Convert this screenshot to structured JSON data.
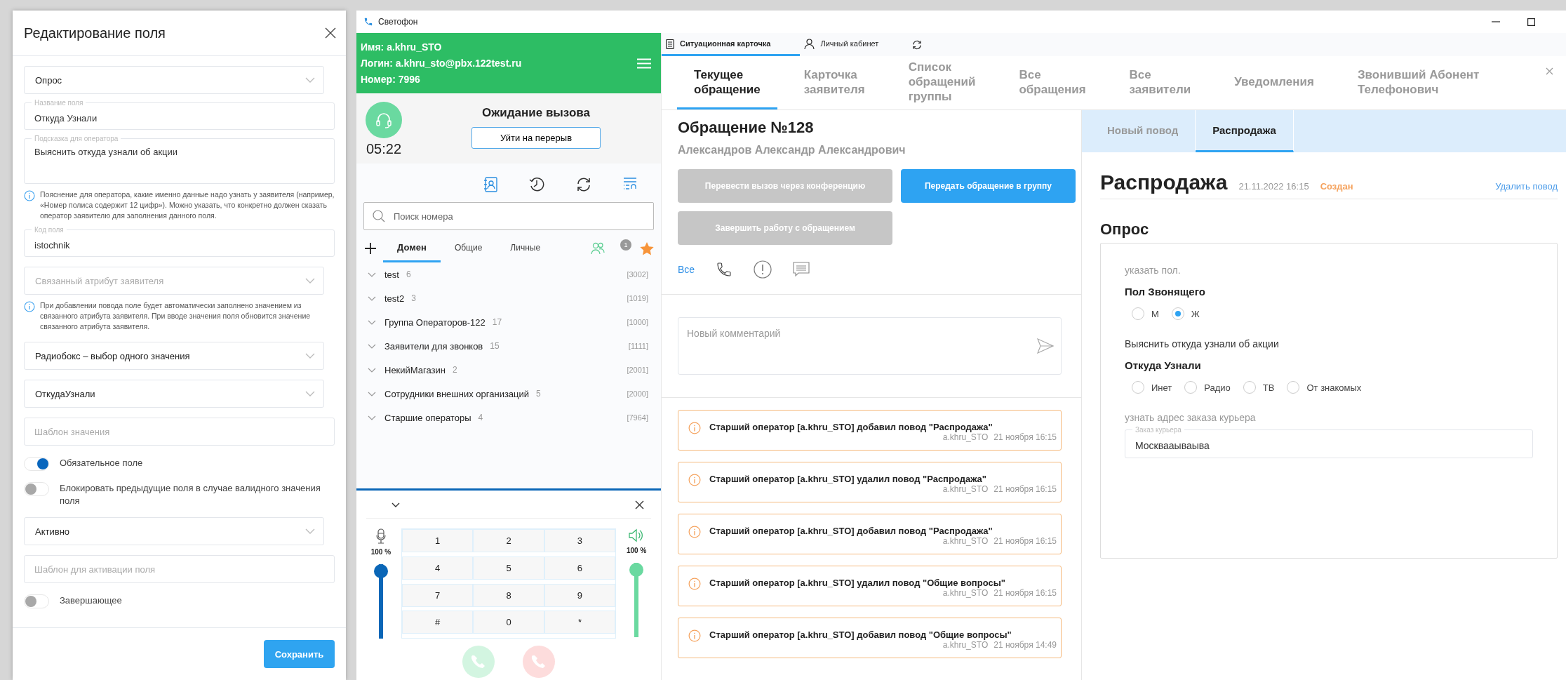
{
  "dialog": {
    "title": "Редактирование поля",
    "fields": [
      {
        "kind": "select",
        "value": "Опрос"
      },
      {
        "kind": "input",
        "label": "Название поля",
        "value": "Откуда Узнали"
      },
      {
        "kind": "textarea",
        "label": "Подсказка для оператора",
        "value": "Выяснить откуда узнали об акции"
      },
      {
        "kind": "hint",
        "text": "Пояснение для оператора, какие именно данные надо узнать у заявителя (например, «Номер полиса содержит 12 цифр»). Можно указать, что конкретно должен сказать оператор заявителю для заполнения данного поля."
      },
      {
        "kind": "input",
        "label": "Код поля",
        "value": "istochnik"
      },
      {
        "kind": "select",
        "placeholder": "Связанный атрибут заявителя"
      },
      {
        "kind": "hint",
        "text": "При добавлении повода поле будет автоматически заполнено значением из связанного атрибута заявителя. При вводе значения поля обновится значение связанного атрибута заявителя."
      },
      {
        "kind": "select",
        "value": "Радиобокс – выбор одного значения"
      },
      {
        "kind": "select",
        "value": "ОткудаУзнали"
      },
      {
        "kind": "input",
        "placeholder": "Шаблон значения"
      },
      {
        "kind": "toggle",
        "label": "Обязательное поле",
        "on": true
      },
      {
        "kind": "toggle",
        "label": "Блокировать предыдущие поля в случае валидного значения поля",
        "on": false
      },
      {
        "kind": "select",
        "value": "Активно"
      },
      {
        "kind": "input",
        "placeholder": "Шаблон для активации поля"
      },
      {
        "kind": "toggle",
        "label": "Завершающее",
        "on": false
      }
    ],
    "save_button": "Сохранить"
  },
  "window": {
    "title": "Светофон"
  },
  "softphone": {
    "user_lines": [
      "Имя: a.khru_STO",
      "Логин: a.khru_sto@pbx.122test.ru",
      "Номер: 7996"
    ],
    "timer": "05:22",
    "status": "Ожидание вызова",
    "break_button": "Уйти на перерыв",
    "search": {
      "placeholder": "Поиск номера"
    },
    "tabs": [
      {
        "label": "Домен",
        "selected": true
      },
      {
        "label": "Общие",
        "selected": false
      },
      {
        "label": "Личные",
        "selected": false
      }
    ],
    "badge": "1",
    "groups": [
      {
        "name": "test",
        "count": "6",
        "number": "[3002]"
      },
      {
        "name": "test2",
        "count": "3",
        "number": "[1019]"
      },
      {
        "name": "Группа Операторов-122",
        "count": "17",
        "number": "[1000]"
      },
      {
        "name": "Заявители для звонков",
        "count": "15",
        "number": "[1111]"
      },
      {
        "name": "НекийМагазин",
        "count": "2",
        "number": "[2001]"
      },
      {
        "name": "Сотрудники внешних организаций",
        "count": "5",
        "number": "[2000]"
      },
      {
        "name": "Старшие операторы",
        "count": "4",
        "number": "[7964]"
      }
    ],
    "mic": {
      "reading": "100 %",
      "level": 1
    },
    "speaker": {
      "reading": "100 %",
      "level": 1
    },
    "keys": [
      "1",
      "2",
      "3",
      "4",
      "5",
      "6",
      "7",
      "8",
      "9",
      "#",
      "0",
      "*"
    ]
  },
  "top_tabs": [
    {
      "label": "Ситуационная карточка",
      "selected": true
    },
    {
      "label": "Личный кабинет",
      "selected": false
    }
  ],
  "nav_tabs": [
    {
      "label": "Текущее\nобращение",
      "selected": true
    },
    {
      "label": "Карточка\nзаявителя",
      "selected": false
    },
    {
      "label": "Список\nобращений\nгруппы",
      "selected": false
    },
    {
      "label": "Все\nобращения",
      "selected": false
    },
    {
      "label": "Все\nзаявители",
      "selected": false
    },
    {
      "label": "Уведомления",
      "selected": false
    },
    {
      "label": "Звонивший Абонент\nТелефонович",
      "selected": false
    }
  ],
  "case": {
    "title": "Обращение №128",
    "person": "Александров Александр Александрович",
    "buttons": [
      {
        "label": "Перевести вызов через конференцию",
        "disabled": true
      },
      {
        "label": "Передать обращение в группу",
        "disabled": false
      },
      {
        "label": "Завершить работу с обращением",
        "disabled": true
      }
    ],
    "filter_all": "Все",
    "comment": {
      "placeholder": "Новый комментарий"
    },
    "events": [
      {
        "text": "Старший оператор [a.khru_STO] добавил повод \"Распродажа\"",
        "author": "a.khru_STO",
        "time": "21 ноября 16:15"
      },
      {
        "text": "Старший оператор [a.khru_STO] удалил повод \"Распродажа\"",
        "author": "a.khru_STO",
        "time": "21 ноября 16:15"
      },
      {
        "text": "Старший оператор [a.khru_STO] добавил повод \"Распродажа\"",
        "author": "a.khru_STO",
        "time": "21 ноября 16:15"
      },
      {
        "text": "Старший оператор [a.khru_STO] удалил повод \"Общие вопросы\"",
        "author": "a.khru_STO",
        "time": "21 ноября 16:15"
      },
      {
        "text": "Старший оператор [a.khru_STO] добавил повод \"Общие вопросы\"",
        "author": "a.khru_STO",
        "time": "21 ноября 14:49"
      }
    ]
  },
  "reason_tabs": [
    {
      "label": "Новый повод",
      "selected": false
    },
    {
      "label": "Распродажа",
      "selected": true
    }
  ],
  "reason": {
    "title": "Распродажа",
    "date": "21.11.2022 16:15",
    "status": "Создан",
    "delete_link": "Удалить повод"
  },
  "survey": {
    "title": "Опрос",
    "questions": [
      {
        "kind": "radio",
        "hint": "указать пол.",
        "muted": true,
        "label": "Пол Звонящего",
        "options": [
          {
            "label": "М",
            "selected": false
          },
          {
            "label": "Ж",
            "selected": true
          }
        ]
      },
      {
        "kind": "radio",
        "hint": "Выяснить откуда узнали об акции",
        "muted": false,
        "label": "Откуда Узнали",
        "options": [
          {
            "label": "Инет",
            "selected": false
          },
          {
            "label": "Радио",
            "selected": false
          },
          {
            "label": "ТВ",
            "selected": false
          },
          {
            "label": "От знакомых",
            "selected": false
          }
        ]
      },
      {
        "kind": "text",
        "hint": "узнать адрес заказа курьера",
        "muted": true,
        "label": "Заказ курьера",
        "value": "Москвааываыва"
      }
    ]
  }
}
